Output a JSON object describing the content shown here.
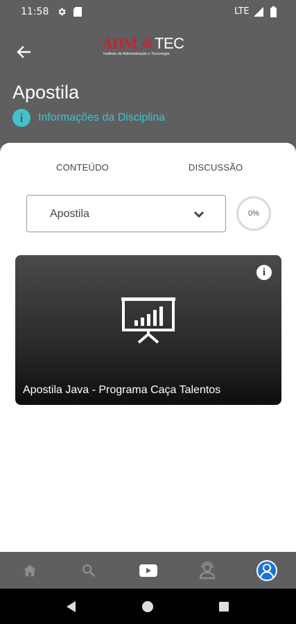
{
  "status_bar": {
    "time": "11:58",
    "network": "LTE"
  },
  "header": {
    "logo": {
      "part1": "ADM",
      "amp": "&",
      "part2": "TEC",
      "subtitle": "Instituto de Administração e Tecnologia"
    },
    "title": "Apostila",
    "info_link": "Informações da Disciplina"
  },
  "tabs": [
    {
      "label": "CONTEÚDO"
    },
    {
      "label": "DISCUSSÃO"
    }
  ],
  "select": {
    "value": "Apostila"
  },
  "progress": {
    "label": "0%",
    "value": 0
  },
  "material_card": {
    "title": "Apostila Java - Programa Caça Talentos",
    "icon": "presentation-chart-icon"
  },
  "bottom_nav": {
    "items": [
      "home-icon",
      "search-icon",
      "video-icon",
      "support-icon",
      "profile-icon"
    ],
    "active": "profile-icon"
  },
  "colors": {
    "header_bg": "#5f5f61",
    "accent": "#3fc3cf",
    "logo_red": "#c8232c",
    "active_nav": "#1a73d9"
  }
}
